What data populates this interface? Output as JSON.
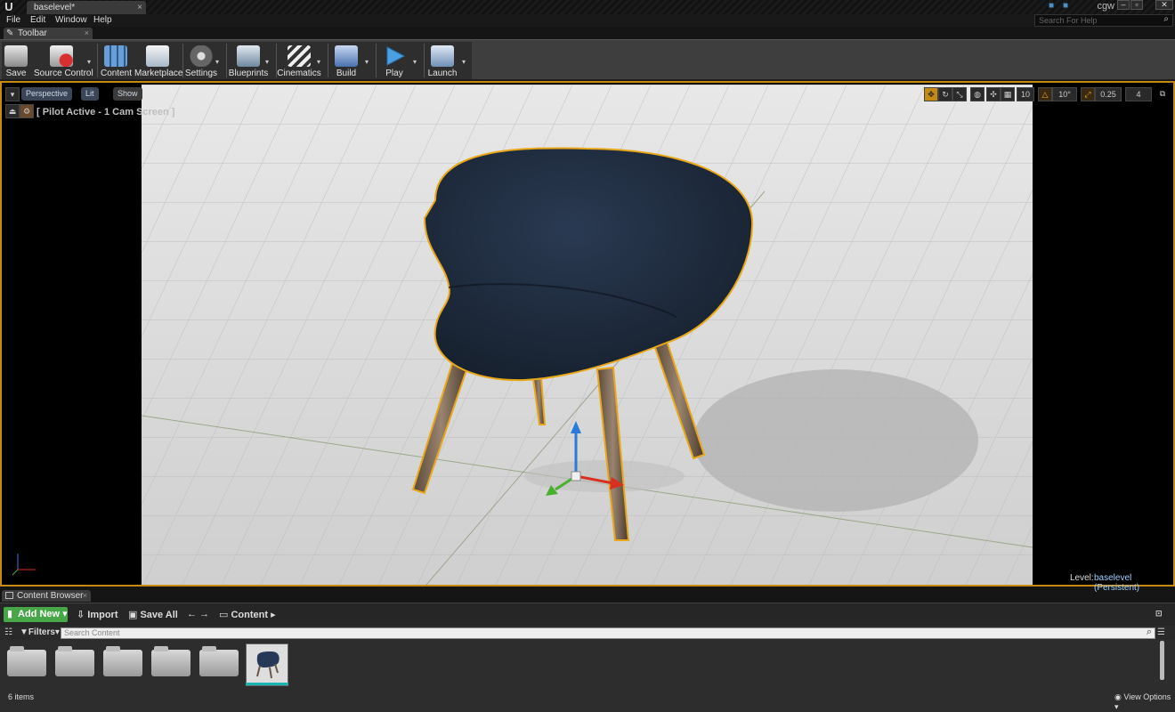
{
  "window": {
    "level_tab": "baselevel*",
    "user": "cgw",
    "help_search_placeholder": "Search For Help"
  },
  "menu": [
    "File",
    "Edit",
    "Window",
    "Help"
  ],
  "toolbar": {
    "tab_label": "Toolbar",
    "buttons": [
      {
        "label": "Save",
        "icon": "save-icon"
      },
      {
        "label": "Source Control",
        "icon": "source-control-icon"
      },
      {
        "label": "Content",
        "icon": "content-icon"
      },
      {
        "label": "Marketplace",
        "icon": "marketplace-icon"
      },
      {
        "label": "Settings",
        "icon": "settings-icon"
      },
      {
        "label": "Blueprints",
        "icon": "blueprints-icon"
      },
      {
        "label": "Cinematics",
        "icon": "cinematics-icon"
      },
      {
        "label": "Build",
        "icon": "build-icon"
      },
      {
        "label": "Play",
        "icon": "play-icon"
      },
      {
        "label": "Launch",
        "icon": "launch-icon"
      }
    ]
  },
  "viewport": {
    "perspective_label": "Perspective",
    "lit_label": "Lit",
    "show_label": "Show",
    "pilot_text": "[ Pilot Active - 1 Cam Screen ]",
    "grid_snap": "10",
    "rotation_snap": "10°",
    "scale_snap": "0.25",
    "camera_speed": "4",
    "level_label": "Level:",
    "level_value": "baselevel (Persistent)"
  },
  "content_browser": {
    "tab_label": "Content Browser",
    "add_new": "Add New",
    "import": "Import",
    "save_all": "Save All",
    "path": "Content",
    "filters": "Filters",
    "search_placeholder": "Search Content",
    "items_count": "6 items",
    "view_options": "View Options"
  },
  "colors": {
    "selection_outline": "#c48a12",
    "add_new_green": "#47a647",
    "chair_fabric": "#1f2b3c"
  }
}
